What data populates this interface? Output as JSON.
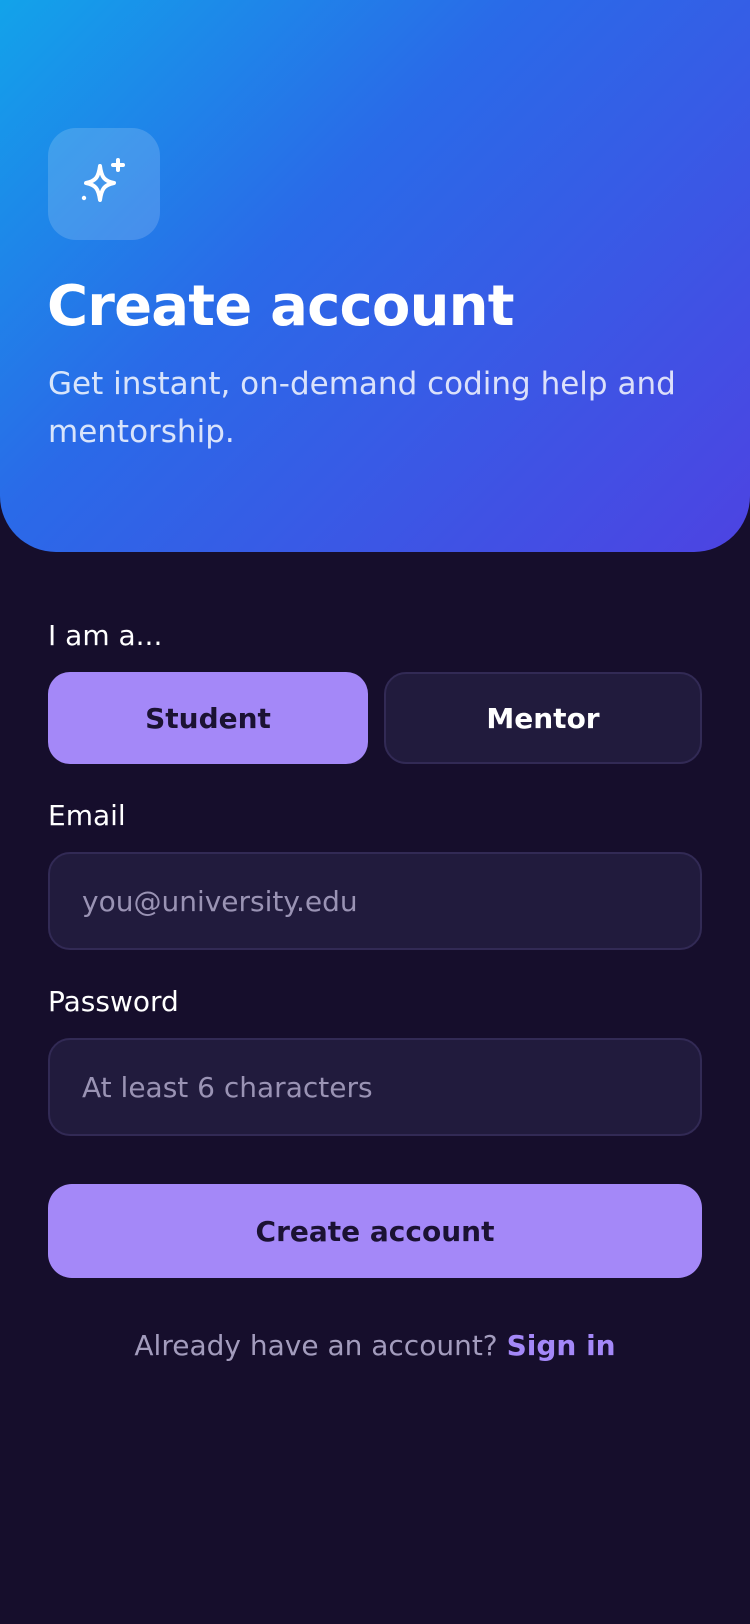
{
  "hero": {
    "logo_icon": "sparkles-icon",
    "title": "Create account",
    "subtitle": "Get instant, on-demand coding help and mentorship."
  },
  "form": {
    "role_label": "I am a...",
    "roles": [
      {
        "label": "Student",
        "selected": true
      },
      {
        "label": "Mentor",
        "selected": false
      }
    ],
    "email_label": "Email",
    "email_placeholder": "you@university.edu",
    "email_value": "",
    "password_label": "Password",
    "password_placeholder": "At least 6 characters",
    "password_value": "",
    "submit_label": "Create account"
  },
  "footer": {
    "prompt": "Already have an account?",
    "link": "Sign in"
  },
  "colors": {
    "background": "#160e2c",
    "accent": "#a488f8",
    "field_bg": "#211b3d",
    "gradient_start": "#12a3ea",
    "gradient_end": "#4d43e2"
  }
}
